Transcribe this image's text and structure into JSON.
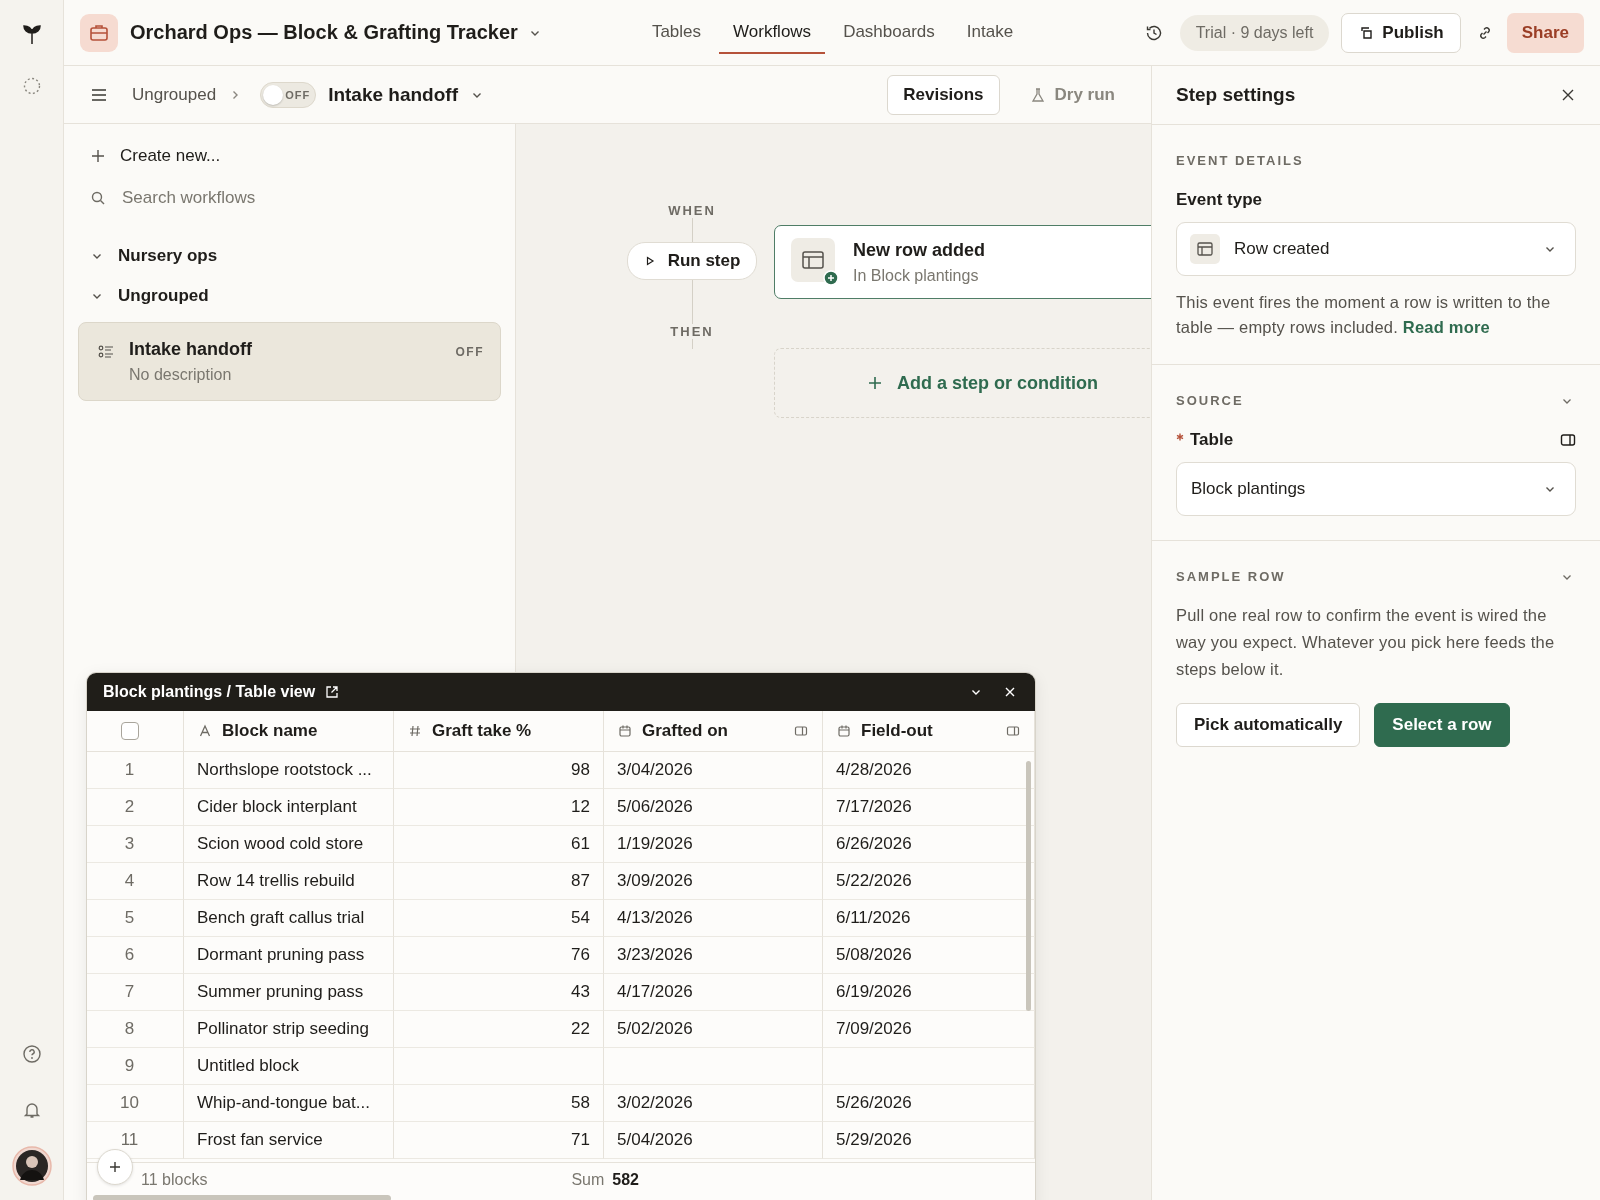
{
  "app": {
    "title": "Orchard Ops — Block & Grafting Tracker",
    "tabs": [
      {
        "label": "Tables",
        "selected": false
      },
      {
        "label": "Workflows",
        "selected": true
      },
      {
        "label": "Dashboards",
        "selected": false
      },
      {
        "label": "Intake",
        "selected": false
      }
    ],
    "trial": "Trial · 9 days left",
    "publish": "Publish",
    "share": "Share"
  },
  "subbar": {
    "breadcrumb": "Ungrouped",
    "toggle": {
      "on": false,
      "label": "OFF"
    },
    "workflow_name": "Intake handoff",
    "revisions": "Revisions",
    "dry_run": "Dry run"
  },
  "sidebar": {
    "create": "Create new...",
    "search_placeholder": "Search workflows",
    "groups": [
      {
        "label": "Nursery ops",
        "expanded": true
      },
      {
        "label": "Ungrouped",
        "expanded": true,
        "children": [
          {
            "title": "Intake handoff",
            "description": "No description",
            "status": "OFF",
            "selected": true
          }
        ]
      }
    ]
  },
  "canvas": {
    "when": "WHEN",
    "run_step": "Run step",
    "trigger": {
      "title": "New row added",
      "subtitle": "In Block plantings"
    },
    "then": "THEN",
    "add_step": "Add a step or condition"
  },
  "step_settings": {
    "title": "Step settings",
    "event_details": {
      "heading": "EVENT DETAILS",
      "field_label": "Event type",
      "value": "Row created",
      "description": "This event fires the moment a row is written to the table — empty rows included.",
      "link": "Read more"
    },
    "source": {
      "heading": "SOURCE",
      "expanded": true,
      "required": true,
      "field_label": "Table",
      "value": "Block plantings"
    },
    "sample_row": {
      "heading": "SAMPLE ROW",
      "expanded": true,
      "text": "Pull one real row to confirm the event is wired the way you expect. Whatever you pick here feeds the steps below it.",
      "buttons": [
        {
          "label": "Pick automatically",
          "kind": "secondary"
        },
        {
          "label": "Select a row",
          "kind": "primary"
        }
      ]
    }
  },
  "table_panel": {
    "title": "Block plantings / Table view",
    "select_all": {
      "checked": false
    },
    "columns": [
      {
        "label": "Block name",
        "kind": "text"
      },
      {
        "label": "Graft take %",
        "kind": "number"
      },
      {
        "label": "Grafted on",
        "kind": "date"
      },
      {
        "label": "Field-out",
        "kind": "date"
      }
    ],
    "rows": [
      {
        "number": "1",
        "cells": [
          "Northslope rootstock ...",
          "98",
          "3/04/2026",
          "4/28/2026"
        ]
      },
      {
        "number": "2",
        "cells": [
          "Cider block interplant",
          "12",
          "5/06/2026",
          "7/17/2026"
        ]
      },
      {
        "number": "3",
        "cells": [
          "Scion wood cold store",
          "61",
          "1/19/2026",
          "6/26/2026"
        ]
      },
      {
        "number": "4",
        "cells": [
          "Row 14 trellis rebuild",
          "87",
          "3/09/2026",
          "5/22/2026"
        ]
      },
      {
        "number": "5",
        "cells": [
          "Bench graft callus trial",
          "54",
          "4/13/2026",
          "6/11/2026"
        ]
      },
      {
        "number": "6",
        "cells": [
          "Dormant pruning pass",
          "76",
          "3/23/2026",
          "5/08/2026"
        ]
      },
      {
        "number": "7",
        "cells": [
          "Summer pruning pass",
          "43",
          "4/17/2026",
          "6/19/2026"
        ]
      },
      {
        "number": "8",
        "cells": [
          "Pollinator strip seeding",
          "22",
          "5/02/2026",
          "7/09/2026"
        ]
      },
      {
        "number": "9",
        "cells": [
          "Untitled block",
          null,
          null,
          null
        ]
      },
      {
        "number": "10",
        "cells": [
          "Whip-and-tongue bat...",
          "58",
          "3/02/2026",
          "5/26/2026"
        ]
      },
      {
        "number": "11",
        "cells": [
          "Frost fan service",
          "71",
          "5/04/2026",
          "5/29/2026"
        ]
      }
    ],
    "footer": {
      "count": "11 blocks",
      "sum_label": "Sum",
      "sum_value": "582"
    }
  }
}
